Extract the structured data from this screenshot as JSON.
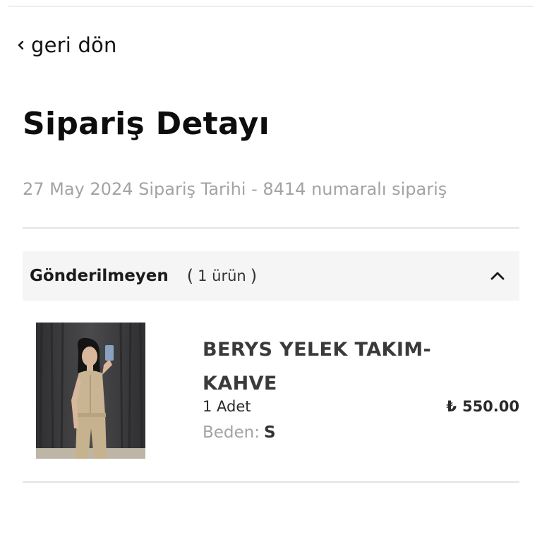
{
  "nav": {
    "back_label": "geri dön",
    "back_icon": "chevron-left-icon"
  },
  "page": {
    "title": "Sipariş Detayı",
    "order_meta": "27 May 2024 Sipariş Tarihi - 8414 numaralı sipariş"
  },
  "group": {
    "title": "Gönderilmeyen",
    "count_open": "(",
    "count_text": "1 ürün",
    "count_close": ")",
    "toggle_icon": "chevron-up-icon"
  },
  "items": [
    {
      "name": "BERYS YELEK TAKIM-KAHVE",
      "quantity": "1 Adet",
      "currency": "₺",
      "price": "550.00",
      "size_label": "Beden:",
      "size_value": "S",
      "image_icon": "product-photo"
    }
  ],
  "colors": {
    "muted_text": "#a3a3a3",
    "header_bg": "#f5f5f5",
    "divider": "#e3e3e3"
  }
}
